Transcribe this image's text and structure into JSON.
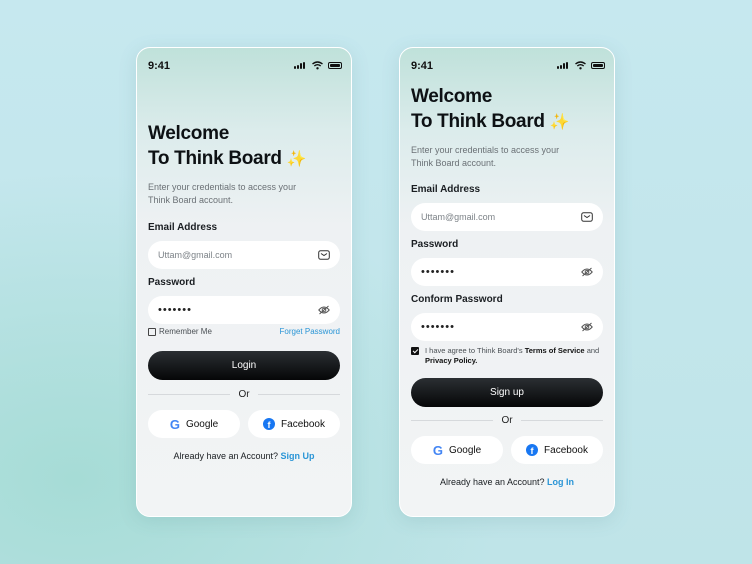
{
  "status": {
    "time": "9:41"
  },
  "login": {
    "title_line1": "Welcome",
    "title_line2": "To Think Board",
    "sparkle": "✨",
    "subtitle": "Enter your credentials to access your Think Board account.",
    "email_label": "Email Address",
    "email_value": "Uttam@gmail.com",
    "password_label": "Password",
    "password_value": "•••••••",
    "remember_label": "Remember Me",
    "forget_label": "Forget Password",
    "submit_label": "Login",
    "or_label": "Or",
    "google_label": "Google",
    "facebook_label": "Facebook",
    "footer_text": "Already have an Account?",
    "footer_link": "Sign Up"
  },
  "signup": {
    "title_line1": "Welcome",
    "title_line2": "To Think Board",
    "sparkle": "✨",
    "subtitle": "Enter your credentials to access your Think Board account.",
    "email_label": "Email Address",
    "email_value": "Uttam@gmail.com",
    "password_label": "Password",
    "password_value": "•••••••",
    "confirm_label": "Conform Password",
    "confirm_value": "•••••••",
    "terms_prefix": "I have agree to Think Board's",
    "terms_link": "Terms of Service",
    "terms_and": "and",
    "privacy_link": "Privacy Policy.",
    "submit_label": "Sign up",
    "or_label": "Or",
    "google_label": "Google",
    "facebook_label": "Facebook",
    "footer_text": "Already have an Account?",
    "footer_link": "Log In"
  },
  "icons": {
    "google": "G",
    "facebook": "f"
  },
  "colors": {
    "accent_link": "#2a95d6",
    "primary_button": "#0b0d0f",
    "facebook": "#1877f2"
  }
}
